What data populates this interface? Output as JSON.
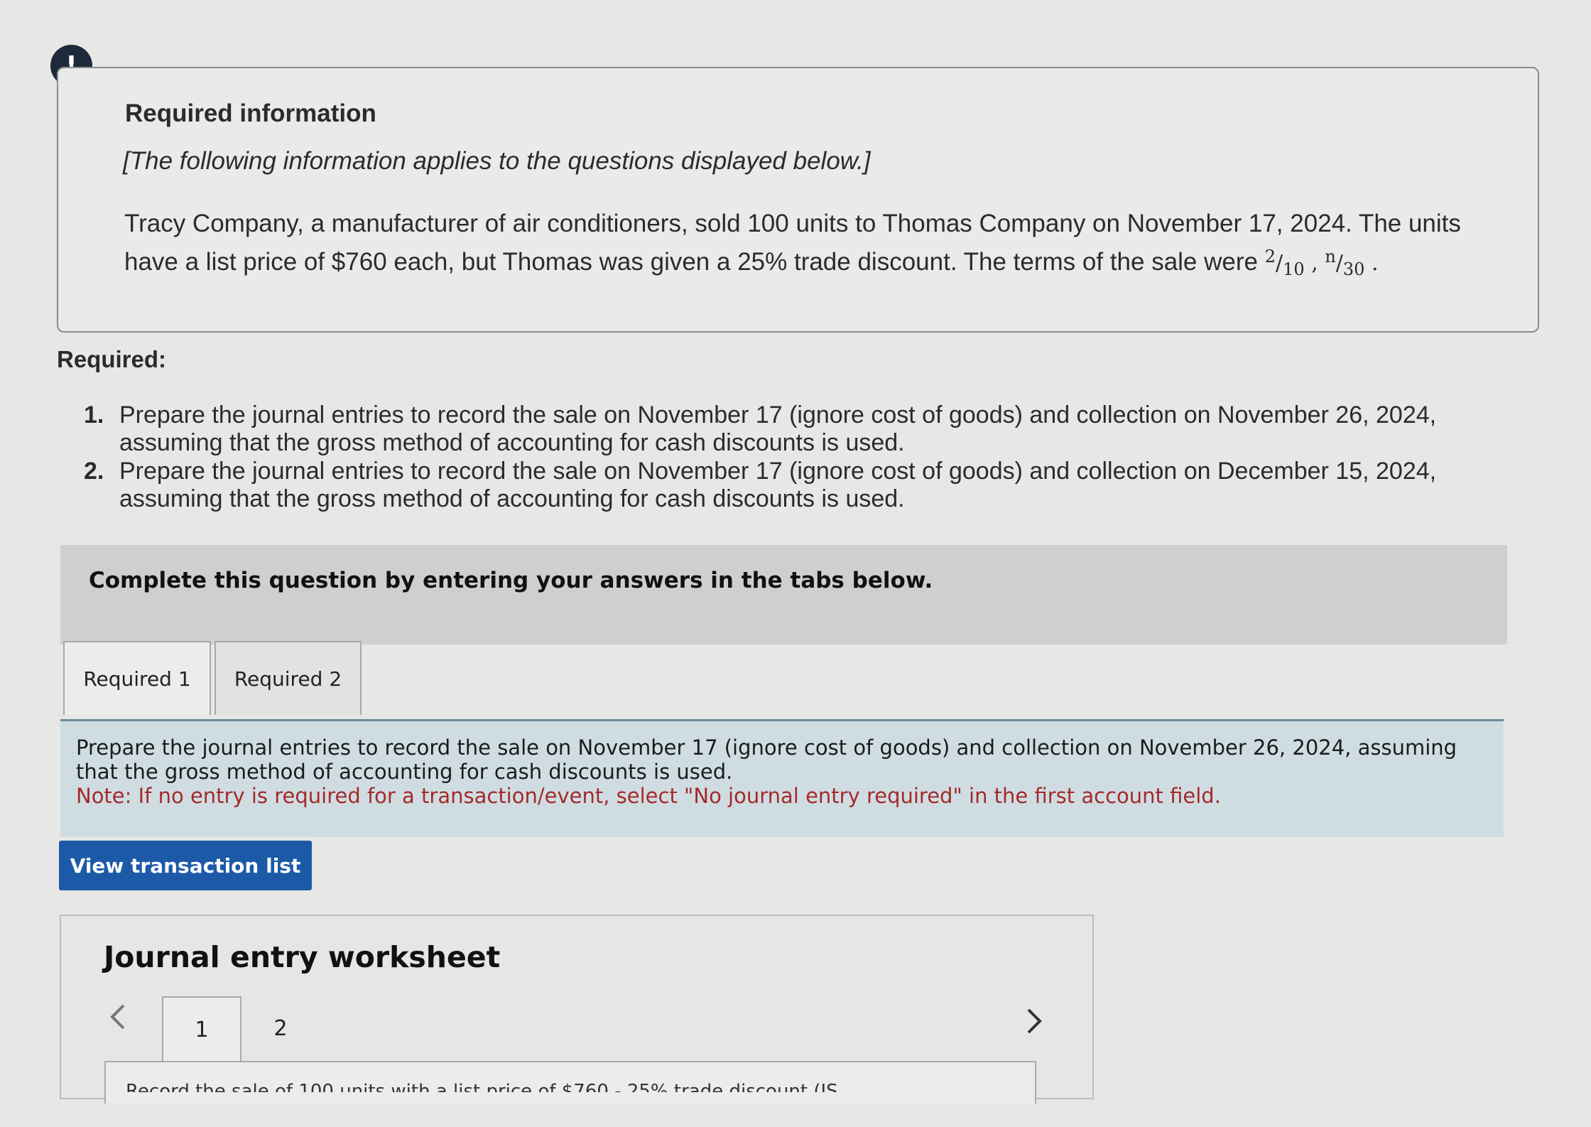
{
  "info": {
    "alert_icon": "exclamation-icon",
    "title": "Required information",
    "subtitle": "[The following information applies to the questions displayed below.]",
    "body": "Tracy Company, a manufacturer of air conditioners, sold 100 units to Thomas Company on November 17, 2024. The units have a list price of $760 each, but Thomas was given a 25% trade discount. The terms of the sale were",
    "terms": {
      "t1_num": "2",
      "t1_den": "10",
      "sep": ",",
      "t2_num": "n",
      "t2_den": "30",
      "end": "."
    }
  },
  "required": {
    "heading": "Required:",
    "items": [
      {
        "num": "1.",
        "text": "Prepare the journal entries to record the sale on November 17 (ignore cost of goods) and collection on November 26, 2024, assuming that the gross method of accounting for cash discounts is used."
      },
      {
        "num": "2.",
        "text": "Prepare the journal entries to record the sale on November 17 (ignore cost of goods) and collection on December 15, 2024, assuming that the gross method of accounting for cash discounts is used."
      }
    ]
  },
  "complete_bar": {
    "text": "Complete this question by entering your answers in the tabs below."
  },
  "tabs": [
    {
      "label": "Required 1",
      "active": true
    },
    {
      "label": "Required 2",
      "active": false
    }
  ],
  "instructions": {
    "text": "Prepare the journal entries to record the sale on November 17 (ignore cost of goods) and collection on November 26, 2024, assuming that the gross method of accounting for cash discounts is used.",
    "note": "Note: If no entry is required for a transaction/event, select \"No journal entry required\" in the first account field."
  },
  "buttons": {
    "view_transaction_list": "View transaction list"
  },
  "worksheet": {
    "title": "Journal entry worksheet",
    "prev_icon": "chevron-left-icon",
    "next_icon": "chevron-right-icon",
    "pages": [
      "1",
      "2"
    ],
    "panel_text": "Record the sale of 100 units with a list price of $760 - 25% trade discount (IS"
  },
  "colors": {
    "accent_button": "#1c5aa8",
    "note_text": "#a42a2a",
    "instruction_bg": "#cfdde2"
  }
}
